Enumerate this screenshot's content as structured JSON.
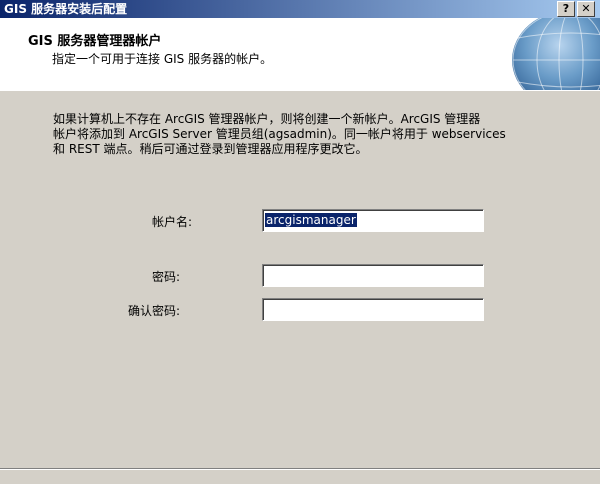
{
  "window": {
    "title": "GIS 服务器安装后配置",
    "help_button": "?",
    "close_button": "✕"
  },
  "header": {
    "title": "GIS 服务器管理器帐户",
    "subtitle": "指定一个可用于连接 GIS 服务器的帐户。",
    "logo_icon": "globe-icon"
  },
  "description": {
    "lines": [
      "如果计算机上不存在 ArcGIS 管理器帐户，则将创建一个新帐户。ArcGIS 管理器",
      "帐户将添加到 ArcGIS Server 管理员组(agsadmin)。同一帐户将用于 webservices",
      "和 REST 端点。稍后可通过登录到管理器应用程序更改它。"
    ]
  },
  "form": {
    "account_label": "帐户名:",
    "account_value": "arcgismanager",
    "password_label": "密码:",
    "password_value": "",
    "confirm_label": "确认密码:",
    "confirm_value": ""
  }
}
